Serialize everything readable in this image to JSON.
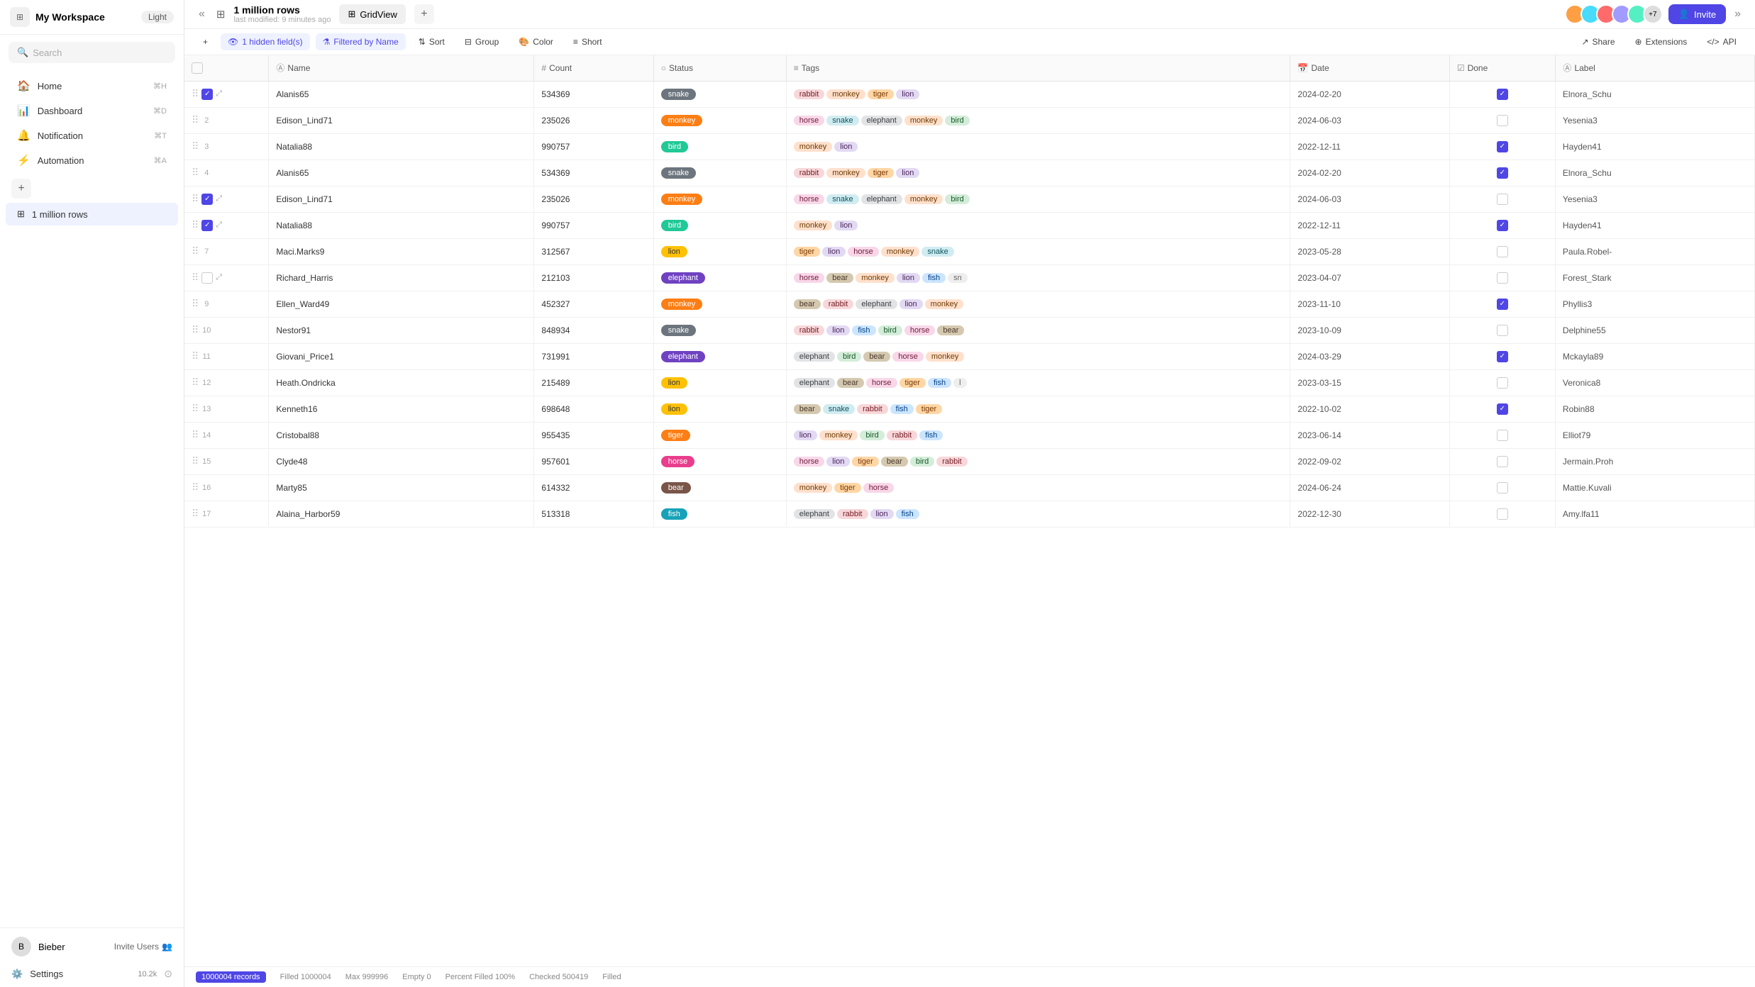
{
  "sidebar": {
    "workspace": "My Workspace",
    "theme": "Light",
    "search_placeholder": "Search",
    "nav": [
      {
        "label": "Home",
        "icon": "🏠",
        "shortcut": "⌘H"
      },
      {
        "label": "Dashboard",
        "icon": "📊",
        "shortcut": "⌘D"
      },
      {
        "label": "Notification",
        "icon": "🔔",
        "shortcut": "⌘T"
      },
      {
        "label": "Automation",
        "icon": "⚡",
        "shortcut": "⌘A"
      }
    ],
    "table_item": "1 million rows",
    "footer": {
      "username": "Bieber",
      "invite_label": "Invite Users",
      "settings_label": "Settings",
      "settings_count": "10.2k"
    }
  },
  "topbar": {
    "table_name": "1 million rows",
    "table_meta": "last modified: 9 minutes ago",
    "view_label": "GridView",
    "collapse_icon": "«",
    "collapse_right_icon": "»",
    "avatars": [
      "+7"
    ],
    "invite_label": "Invite"
  },
  "toolbar": {
    "hidden_fields": "1 hidden field(s)",
    "filtered_by": "Filtered by Name",
    "sort": "Sort",
    "group": "Group",
    "color": "Color",
    "short": "Short",
    "share": "Share",
    "extensions": "Extensions",
    "api": "API"
  },
  "columns": [
    "Name",
    "Count",
    "Status",
    "Tags",
    "Date",
    "Done",
    "Label"
  ],
  "rows": [
    {
      "num": "",
      "checked": true,
      "name": "Alanis65",
      "count": "534369",
      "status": "snake",
      "tags": [
        "rabbit",
        "monkey",
        "tiger",
        "lion"
      ],
      "date": "2024-02-20",
      "done": true,
      "label": "Elnora_Schu"
    },
    {
      "num": "2",
      "checked": false,
      "name": "Edison_Lind71",
      "count": "235026",
      "status": "monkey",
      "tags": [
        "horse",
        "snake",
        "elephant",
        "monkey",
        "bird"
      ],
      "date": "2024-06-03",
      "done": false,
      "label": "Yesenia3"
    },
    {
      "num": "3",
      "checked": false,
      "name": "Natalia88",
      "count": "990757",
      "status": "bird",
      "tags": [
        "monkey",
        "lion"
      ],
      "date": "2022-12-11",
      "done": true,
      "label": "Hayden41"
    },
    {
      "num": "4",
      "checked": false,
      "name": "Alanis65",
      "count": "534369",
      "status": "snake",
      "tags": [
        "rabbit",
        "monkey",
        "tiger",
        "lion"
      ],
      "date": "2024-02-20",
      "done": true,
      "label": "Elnora_Schu"
    },
    {
      "num": "",
      "checked": true,
      "name": "Edison_Lind71",
      "count": "235026",
      "status": "monkey",
      "tags": [
        "horse",
        "snake",
        "elephant",
        "monkey",
        "bird"
      ],
      "date": "2024-06-03",
      "done": false,
      "label": "Yesenia3"
    },
    {
      "num": "",
      "checked": true,
      "name": "Natalia88",
      "count": "990757",
      "status": "bird",
      "tags": [
        "monkey",
        "lion"
      ],
      "date": "2022-12-11",
      "done": true,
      "label": "Hayden41"
    },
    {
      "num": "7",
      "checked": false,
      "name": "Maci.Marks9",
      "count": "312567",
      "status": "lion",
      "tags": [
        "tiger",
        "lion",
        "horse",
        "monkey",
        "snake"
      ],
      "date": "2023-05-28",
      "done": false,
      "label": "Paula.Robel-"
    },
    {
      "num": "",
      "checked": false,
      "name": "Richard_Harris",
      "count": "212103",
      "status": "elephant",
      "tags": [
        "horse",
        "bear",
        "monkey",
        "lion",
        "fish",
        "sn"
      ],
      "date": "2023-04-07",
      "done": false,
      "label": "Forest_Stark"
    },
    {
      "num": "9",
      "checked": false,
      "name": "Ellen_Ward49",
      "count": "452327",
      "status": "monkey",
      "tags": [
        "bear",
        "rabbit",
        "elephant",
        "lion",
        "monkey"
      ],
      "date": "2023-11-10",
      "done": true,
      "label": "Phyllis3"
    },
    {
      "num": "10",
      "checked": false,
      "name": "Nestor91",
      "count": "848934",
      "status": "snake",
      "tags": [
        "rabbit",
        "lion",
        "fish",
        "bird",
        "horse",
        "bear"
      ],
      "date": "2023-10-09",
      "done": false,
      "label": "Delphine55"
    },
    {
      "num": "11",
      "checked": false,
      "name": "Giovani_Price1",
      "count": "731991",
      "status": "elephant",
      "tags": [
        "elephant",
        "bird",
        "bear",
        "horse",
        "monkey"
      ],
      "date": "2024-03-29",
      "done": true,
      "label": "Mckayla89"
    },
    {
      "num": "12",
      "checked": false,
      "name": "Heath.Ondricka",
      "count": "215489",
      "status": "lion",
      "tags": [
        "elephant",
        "bear",
        "horse",
        "tiger",
        "fish",
        "l"
      ],
      "date": "2023-03-15",
      "done": false,
      "label": "Veronica8"
    },
    {
      "num": "13",
      "checked": false,
      "name": "Kenneth16",
      "count": "698648",
      "status": "lion",
      "tags": [
        "bear",
        "snake",
        "rabbit",
        "fish",
        "tiger"
      ],
      "date": "2022-10-02",
      "done": true,
      "label": "Robin88"
    },
    {
      "num": "14",
      "checked": false,
      "name": "Cristobal88",
      "count": "955435",
      "status": "tiger",
      "tags": [
        "lion",
        "monkey",
        "bird",
        "rabbit",
        "fish"
      ],
      "date": "2023-06-14",
      "done": false,
      "label": "Elliot79"
    },
    {
      "num": "15",
      "checked": false,
      "name": "Clyde48",
      "count": "957601",
      "status": "horse",
      "tags": [
        "horse",
        "lion",
        "tiger",
        "bear",
        "bird",
        "rabbit"
      ],
      "date": "2022-09-02",
      "done": false,
      "label": "Jermain.Proh"
    },
    {
      "num": "16",
      "checked": false,
      "name": "Marty85",
      "count": "614332",
      "status": "bear",
      "tags": [
        "monkey",
        "tiger",
        "horse"
      ],
      "date": "2024-06-24",
      "done": false,
      "label": "Mattie.Kuvali"
    },
    {
      "num": "17",
      "checked": false,
      "name": "Alaina_Harbor59",
      "count": "513318",
      "status": "fish",
      "tags": [
        "elephant",
        "rabbit",
        "lion",
        "fish"
      ],
      "date": "2022-12-30",
      "done": false,
      "label": "Amy.lfa11"
    }
  ],
  "footer": {
    "records": "1000004 records",
    "filled": "Filled 1000004",
    "max": "Max 999996",
    "empty": "Empty 0",
    "percent": "Percent Filled 100%",
    "checked": "Checked 500419",
    "filled_label": "Filled"
  }
}
